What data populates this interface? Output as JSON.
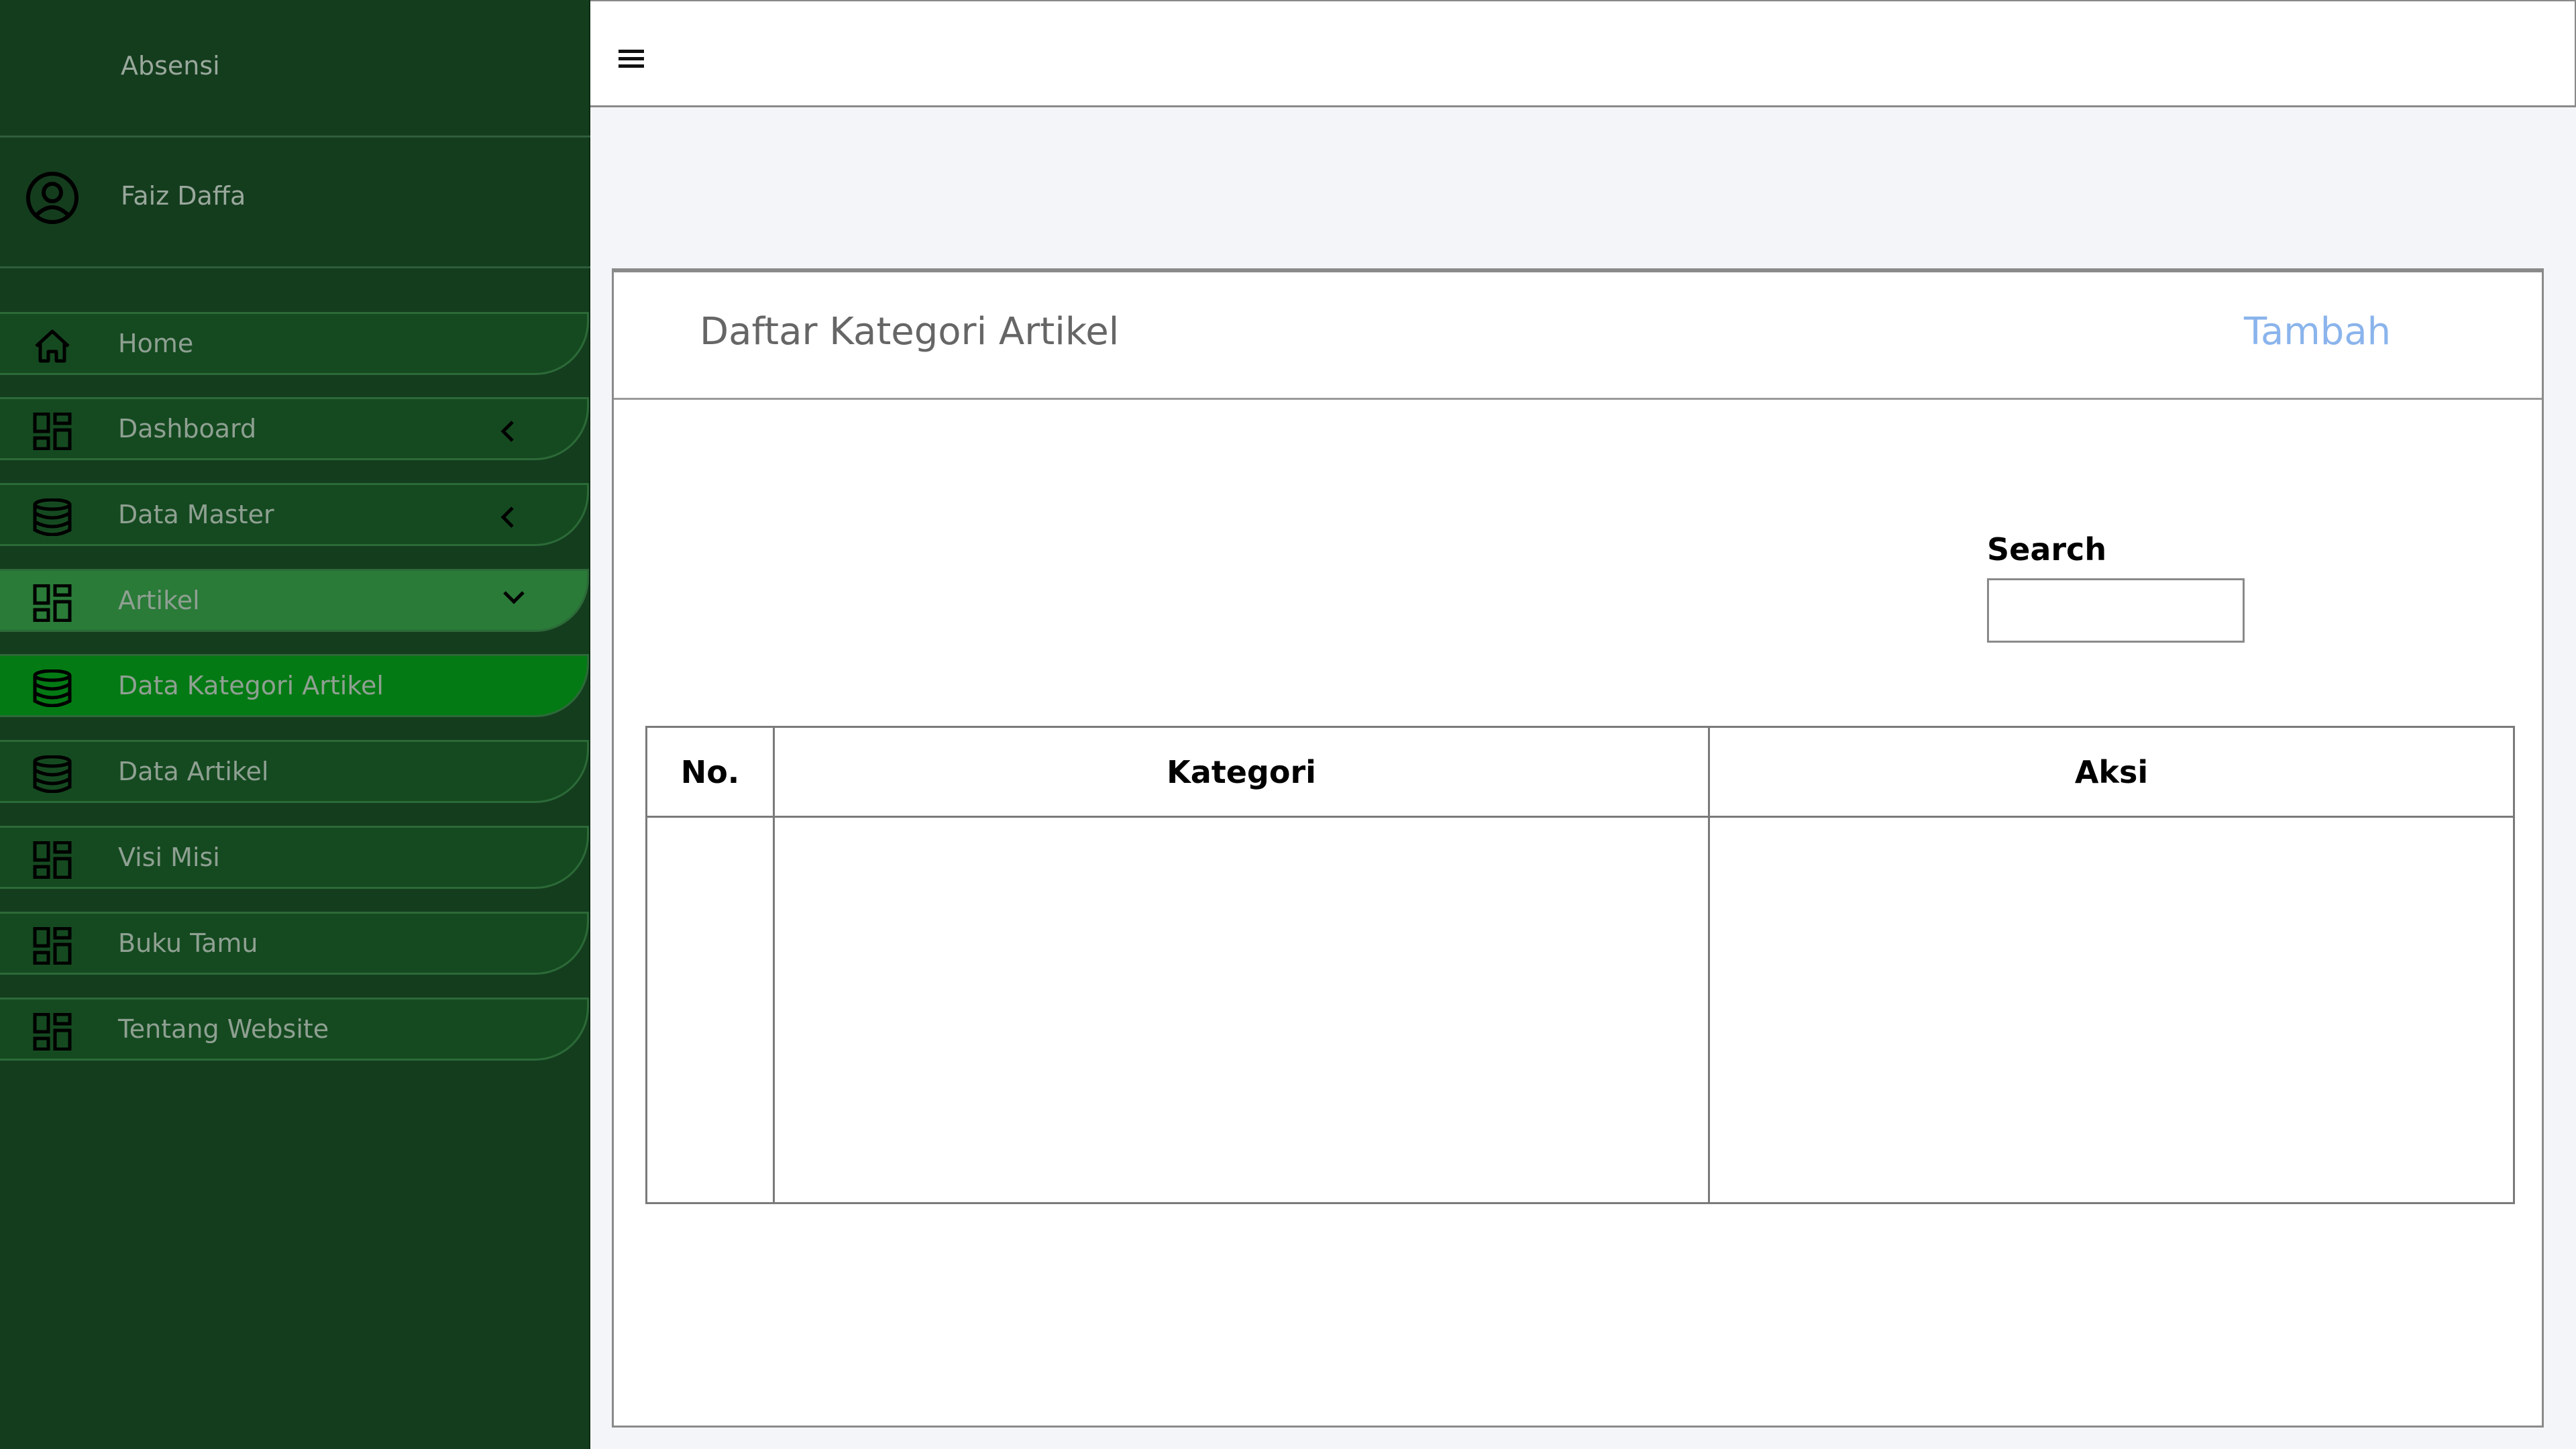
{
  "sidebar": {
    "brand": "Absensi",
    "user_name": "Faiz Daffa",
    "items": [
      {
        "label": "Home",
        "icon": "home-icon"
      },
      {
        "label": "Dashboard",
        "icon": "dashboard-icon",
        "chevron": "chevron-left-icon"
      },
      {
        "label": "Data Master",
        "icon": "database-icon",
        "chevron": "chevron-left-icon"
      },
      {
        "label": "Artikel",
        "icon": "dashboard-icon",
        "chevron": "chevron-down-icon"
      },
      {
        "label": "Data Kategori Artikel",
        "icon": "database-icon"
      },
      {
        "label": "Data Artikel",
        "icon": "database-icon"
      },
      {
        "label": "Visi Misi",
        "icon": "dashboard-icon"
      },
      {
        "label": "Buku Tamu",
        "icon": "dashboard-icon"
      },
      {
        "label": "Tentang Website",
        "icon": "dashboard-icon"
      }
    ]
  },
  "topbar": {
    "menu_icon": "hamburger-icon"
  },
  "card": {
    "title": "Daftar Kategori Artikel",
    "add_label": "Tambah",
    "search_label": "Search",
    "search_value": "",
    "table": {
      "headers": [
        "No.",
        "Kategori",
        "Aksi"
      ],
      "rows": []
    }
  },
  "colors": {
    "sidebar_bg": "#143d1e",
    "menu_item_bg": "#154a20",
    "active_parent_bg": "#2a7a38",
    "active_child_bg": "#047a14",
    "add_link": "#8ab4ec"
  }
}
